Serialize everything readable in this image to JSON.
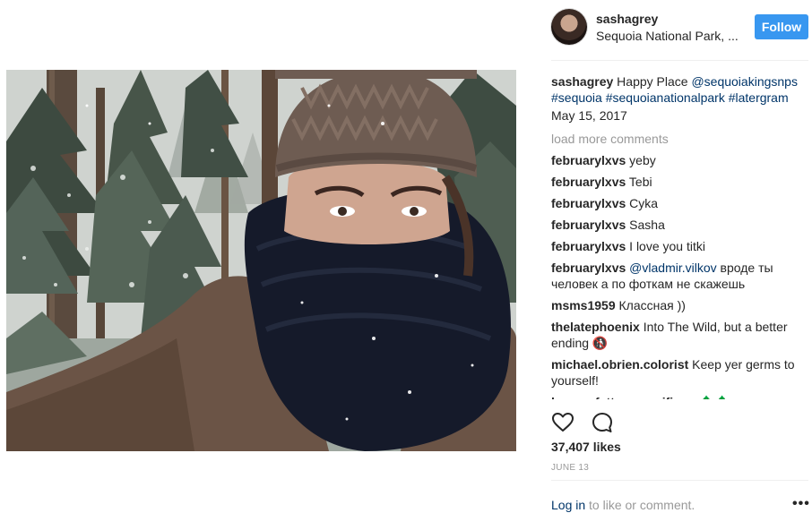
{
  "header": {
    "username": "sashagrey",
    "location": "Sequoia National Park, ...",
    "follow_label": "Follow"
  },
  "caption": {
    "username": "sashagrey",
    "text": "Happy Place",
    "mention": "@sequoiakingsnps",
    "hashtags": "#sequoia #sequoianationalpark #latergram",
    "date": "May 15, 2017"
  },
  "comments": {
    "load_more": "load more comments",
    "items": [
      {
        "user": "februarylxvs",
        "text": "yeby"
      },
      {
        "user": "februarylxvs",
        "text": "Tebi"
      },
      {
        "user": "februarylxvs",
        "text": "Cyka"
      },
      {
        "user": "februarylxvs",
        "text": "Sasha"
      },
      {
        "user": "februarylxvs",
        "text": "I love you titki"
      },
      {
        "user": "februarylxvs",
        "mention": "@vladmir.vilkov",
        "text": "вроде ты человек а по фоткам не скажешь"
      },
      {
        "user": "msms1959",
        "text": "Классная ))"
      },
      {
        "user": "thelatephoenix",
        "text": "Into The Wild, but a better ending 🚯"
      },
      {
        "user": "michael.obrien.colorist",
        "text": "Keep yer germs to yourself!"
      },
      {
        "user": "la_moufette_magnifique",
        "text": "🌲🌲"
      }
    ]
  },
  "actions": {
    "like_icon": "heart-icon",
    "comment_icon": "comment-bubble-icon"
  },
  "likes": "37,407 likes",
  "post_date": "JUNE 13",
  "footer": {
    "login_link": "Log in",
    "login_rest": "to like or comment.",
    "more_icon": "more-options-icon"
  },
  "colors": {
    "follow_button": "#3897f0",
    "link": "#003569",
    "muted": "#999999",
    "text": "#262626"
  }
}
